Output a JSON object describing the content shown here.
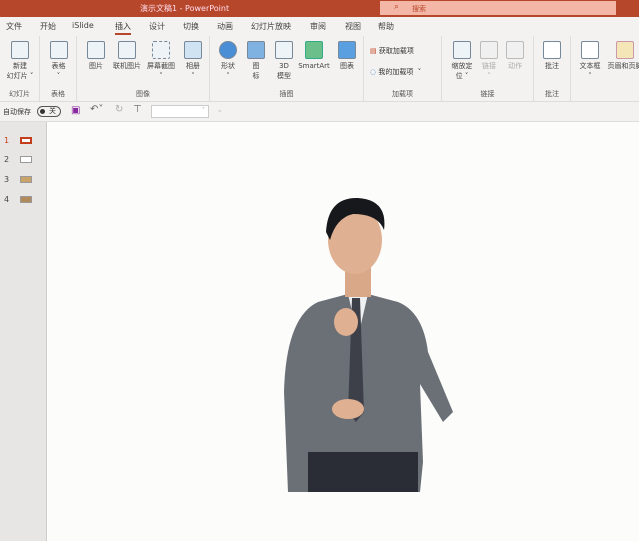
{
  "titlebar": {
    "title": "演示文稿1  -  PowerPoint",
    "search_placeholder": "搜索",
    "search_icon": "search-icon"
  },
  "tabs": [
    "文件",
    "开始",
    "iSlide",
    "插入",
    "设计",
    "切换",
    "动画",
    "幻灯片放映",
    "审阅",
    "视图",
    "帮助"
  ],
  "active_tab": "插入",
  "ribbon": {
    "groups": [
      {
        "label": "幻灯片",
        "buttons": [
          "新建\n幻灯片 ˅"
        ]
      },
      {
        "label": "表格",
        "buttons": [
          "表格\n˅"
        ]
      },
      {
        "label": "图像",
        "buttons": [
          "图片",
          "联机图片",
          "屏幕截图\n˅",
          "相册\n˅"
        ]
      },
      {
        "label": "插图",
        "buttons": [
          "形状\n˅",
          "图\n标",
          "3D\n模型",
          "SmartArt",
          "图表"
        ]
      },
      {
        "label": "加载项",
        "buttons": [
          "获取加载项",
          "我的加载项  ˅"
        ]
      },
      {
        "label": "链接",
        "buttons": [
          "缩放定\n位 ˅",
          "链接\n˅",
          "动作"
        ]
      },
      {
        "label": "批注",
        "buttons": [
          "批注"
        ]
      },
      {
        "label": "",
        "buttons": [
          "文本框\n˅",
          "页眉和页脚"
        ]
      }
    ]
  },
  "qat": {
    "autosave_label": "自动保存",
    "toggle_state": "关",
    "font_box": ""
  },
  "thumbnails": [
    {
      "num": "1",
      "selected": true
    },
    {
      "num": "2"
    },
    {
      "num": "3"
    },
    {
      "num": "4"
    }
  ],
  "colors": {
    "accent": "#b7472a"
  }
}
